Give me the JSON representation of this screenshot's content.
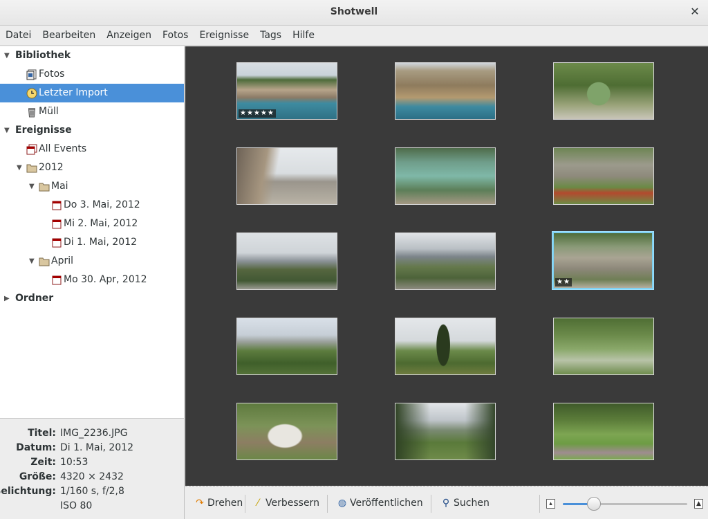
{
  "window": {
    "title": "Shotwell",
    "close_glyph": "✕"
  },
  "menu": [
    "Datei",
    "Bearbeiten",
    "Anzeigen",
    "Fotos",
    "Ereignisse",
    "Tags",
    "Hilfe"
  ],
  "sidebar": {
    "library_header": "Bibliothek",
    "photos": "Fotos",
    "last_import": "Letzter Import",
    "trash": "Müll",
    "events_header": "Ereignisse",
    "all_events": "All Events",
    "year_2012": "2012",
    "may": "Mai",
    "may3": "Do 3. Mai, 2012",
    "may2": "Mi 2. Mai, 2012",
    "may1": "Di 1. Mai, 2012",
    "april": "April",
    "apr30": "Mo 30. Apr, 2012",
    "folders_header": "Ordner"
  },
  "info": {
    "title_label": "Titel:",
    "title_value": "IMG_2236.JPG",
    "date_label": "Datum:",
    "date_value": "Di 1. Mai, 2012",
    "time_label": "Zeit:",
    "time_value": "10:53",
    "size_label": "Größe:",
    "size_value": "4320 × 2432",
    "exposure_label": "Belichtung:",
    "exposure_value": "1/160 s, f/2,8",
    "iso_value": "ISO 80"
  },
  "photos": [
    {
      "stars": "★★★★★",
      "scene": "coast"
    },
    {
      "stars": "",
      "scene": "cliff"
    },
    {
      "stars": "",
      "scene": "cactus"
    },
    {
      "stars": "",
      "scene": "beach"
    },
    {
      "stars": "",
      "scene": "lake"
    },
    {
      "stars": "",
      "scene": "ruins-flowers"
    },
    {
      "stars": "",
      "scene": "mountain-haze"
    },
    {
      "stars": "",
      "scene": "mountain-haze2"
    },
    {
      "stars": "★★",
      "scene": "ruins",
      "selected": true
    },
    {
      "stars": "",
      "scene": "mountain-green"
    },
    {
      "stars": "",
      "scene": "cypress"
    },
    {
      "stars": "",
      "scene": "meadow"
    },
    {
      "stars": "",
      "scene": "rock-path"
    },
    {
      "stars": "",
      "scene": "valley"
    },
    {
      "stars": "",
      "scene": "garden"
    }
  ],
  "toolbar": {
    "rotate": "Drehen",
    "enhance": "Verbessern",
    "publish": "Veröffentlichen",
    "search": "Suchen",
    "zoom_level": 0.25
  },
  "colors": {
    "selection": "#4a90d9",
    "viewer_bg": "#3a3a3a",
    "thumb_selected_border": "#7fd0f0"
  }
}
